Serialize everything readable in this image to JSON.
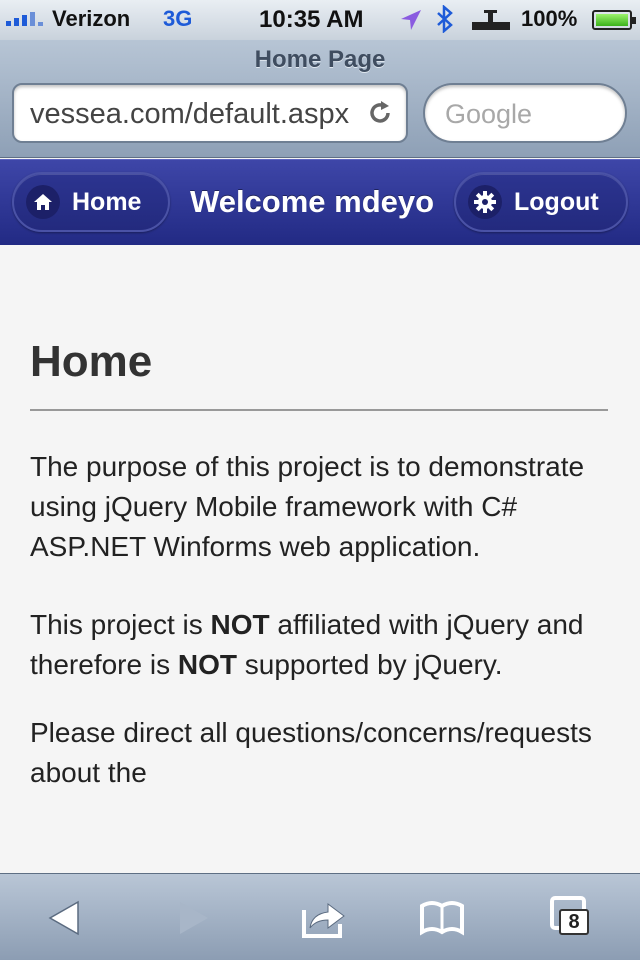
{
  "status_bar": {
    "carrier": "Verizon",
    "network": "3G",
    "time": "10:35 AM",
    "battery_percent": "100%",
    "icons": [
      "signal-icon",
      "location-icon",
      "bluetooth-icon",
      "alarm-icon",
      "battery-icon"
    ]
  },
  "browser": {
    "page_title": "Home Page",
    "url": "vessea.com/default.aspx",
    "search_placeholder": "Google"
  },
  "header": {
    "home_label": "Home",
    "title": "Welcome mdeyo",
    "logout_label": "Logout",
    "color": "#2a3290"
  },
  "content": {
    "heading": "Home",
    "paragraph1": "The purpose of this project is to demonstrate using jQuery Mobile framework with C# ASP.NET Winforms web application.",
    "paragraph2_part1": "This project is ",
    "paragraph2_bold1": "NOT",
    "paragraph2_part2": " affiliated with jQuery and therefore is ",
    "paragraph2_bold2": "NOT",
    "paragraph2_part3": " supported by jQuery.",
    "paragraph3": "Please direct all questions/concerns/requests about the"
  },
  "toolbar": {
    "tab_count": "8",
    "icons": [
      "back-icon",
      "forward-icon",
      "share-icon",
      "bookmarks-icon",
      "tabs-icon"
    ]
  }
}
